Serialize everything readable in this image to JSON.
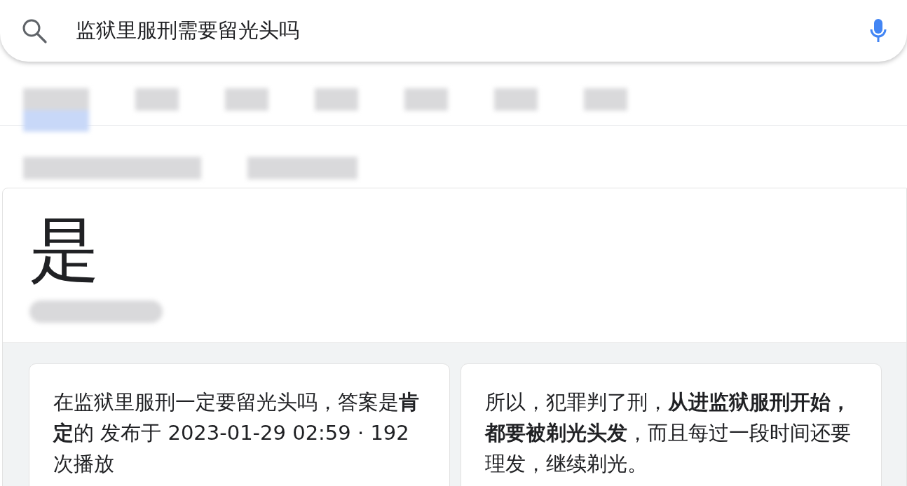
{
  "search": {
    "value": "监狱里服刑需要留光头吗"
  },
  "tabs": [
    {
      "kind": "redacted",
      "selected": true
    },
    {
      "kind": "redacted",
      "selected": false
    },
    {
      "kind": "redacted",
      "selected": false
    },
    {
      "kind": "redacted",
      "selected": false
    },
    {
      "kind": "redacted",
      "selected": false
    },
    {
      "kind": "redacted",
      "selected": false
    },
    {
      "kind": "redacted",
      "selected": false
    }
  ],
  "chips": [
    {
      "kind": "redacted"
    },
    {
      "kind": "redacted"
    }
  ],
  "answer": {
    "title": "是",
    "source": {
      "kind": "redacted"
    }
  },
  "snippets": [
    {
      "text": "在监狱里服刑一定要留光头吗，答案是**肯定**的 发布于 2023-01-29 02:59 · 192 次播放"
    },
    {
      "text": "所以，犯罪判了刑，**从进监狱服刑开始，都要被剃光头发**，而且每过一段时间还要理发，继续剃光。"
    }
  ]
}
